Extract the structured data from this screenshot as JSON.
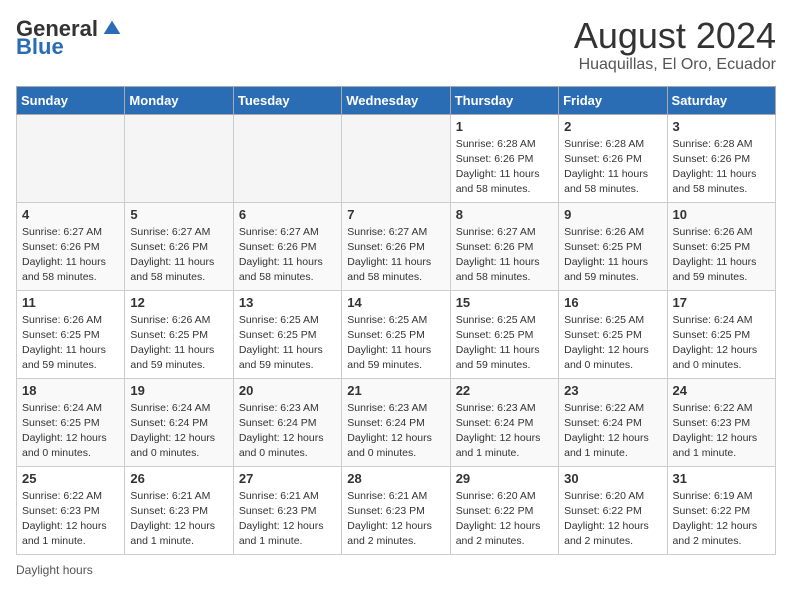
{
  "logo": {
    "general": "General",
    "blue": "Blue"
  },
  "title": "August 2024",
  "subtitle": "Huaquillas, El Oro, Ecuador",
  "weekdays": [
    "Sunday",
    "Monday",
    "Tuesday",
    "Wednesday",
    "Thursday",
    "Friday",
    "Saturday"
  ],
  "weeks": [
    [
      {
        "day": "",
        "info": ""
      },
      {
        "day": "",
        "info": ""
      },
      {
        "day": "",
        "info": ""
      },
      {
        "day": "",
        "info": ""
      },
      {
        "day": "1",
        "info": "Sunrise: 6:28 AM\nSunset: 6:26 PM\nDaylight: 11 hours and 58 minutes."
      },
      {
        "day": "2",
        "info": "Sunrise: 6:28 AM\nSunset: 6:26 PM\nDaylight: 11 hours and 58 minutes."
      },
      {
        "day": "3",
        "info": "Sunrise: 6:28 AM\nSunset: 6:26 PM\nDaylight: 11 hours and 58 minutes."
      }
    ],
    [
      {
        "day": "4",
        "info": "Sunrise: 6:27 AM\nSunset: 6:26 PM\nDaylight: 11 hours and 58 minutes."
      },
      {
        "day": "5",
        "info": "Sunrise: 6:27 AM\nSunset: 6:26 PM\nDaylight: 11 hours and 58 minutes."
      },
      {
        "day": "6",
        "info": "Sunrise: 6:27 AM\nSunset: 6:26 PM\nDaylight: 11 hours and 58 minutes."
      },
      {
        "day": "7",
        "info": "Sunrise: 6:27 AM\nSunset: 6:26 PM\nDaylight: 11 hours and 58 minutes."
      },
      {
        "day": "8",
        "info": "Sunrise: 6:27 AM\nSunset: 6:26 PM\nDaylight: 11 hours and 58 minutes."
      },
      {
        "day": "9",
        "info": "Sunrise: 6:26 AM\nSunset: 6:25 PM\nDaylight: 11 hours and 59 minutes."
      },
      {
        "day": "10",
        "info": "Sunrise: 6:26 AM\nSunset: 6:25 PM\nDaylight: 11 hours and 59 minutes."
      }
    ],
    [
      {
        "day": "11",
        "info": "Sunrise: 6:26 AM\nSunset: 6:25 PM\nDaylight: 11 hours and 59 minutes."
      },
      {
        "day": "12",
        "info": "Sunrise: 6:26 AM\nSunset: 6:25 PM\nDaylight: 11 hours and 59 minutes."
      },
      {
        "day": "13",
        "info": "Sunrise: 6:25 AM\nSunset: 6:25 PM\nDaylight: 11 hours and 59 minutes."
      },
      {
        "day": "14",
        "info": "Sunrise: 6:25 AM\nSunset: 6:25 PM\nDaylight: 11 hours and 59 minutes."
      },
      {
        "day": "15",
        "info": "Sunrise: 6:25 AM\nSunset: 6:25 PM\nDaylight: 11 hours and 59 minutes."
      },
      {
        "day": "16",
        "info": "Sunrise: 6:25 AM\nSunset: 6:25 PM\nDaylight: 12 hours and 0 minutes."
      },
      {
        "day": "17",
        "info": "Sunrise: 6:24 AM\nSunset: 6:25 PM\nDaylight: 12 hours and 0 minutes."
      }
    ],
    [
      {
        "day": "18",
        "info": "Sunrise: 6:24 AM\nSunset: 6:25 PM\nDaylight: 12 hours and 0 minutes."
      },
      {
        "day": "19",
        "info": "Sunrise: 6:24 AM\nSunset: 6:24 PM\nDaylight: 12 hours and 0 minutes."
      },
      {
        "day": "20",
        "info": "Sunrise: 6:23 AM\nSunset: 6:24 PM\nDaylight: 12 hours and 0 minutes."
      },
      {
        "day": "21",
        "info": "Sunrise: 6:23 AM\nSunset: 6:24 PM\nDaylight: 12 hours and 0 minutes."
      },
      {
        "day": "22",
        "info": "Sunrise: 6:23 AM\nSunset: 6:24 PM\nDaylight: 12 hours and 1 minute."
      },
      {
        "day": "23",
        "info": "Sunrise: 6:22 AM\nSunset: 6:24 PM\nDaylight: 12 hours and 1 minute."
      },
      {
        "day": "24",
        "info": "Sunrise: 6:22 AM\nSunset: 6:23 PM\nDaylight: 12 hours and 1 minute."
      }
    ],
    [
      {
        "day": "25",
        "info": "Sunrise: 6:22 AM\nSunset: 6:23 PM\nDaylight: 12 hours and 1 minute."
      },
      {
        "day": "26",
        "info": "Sunrise: 6:21 AM\nSunset: 6:23 PM\nDaylight: 12 hours and 1 minute."
      },
      {
        "day": "27",
        "info": "Sunrise: 6:21 AM\nSunset: 6:23 PM\nDaylight: 12 hours and 1 minute."
      },
      {
        "day": "28",
        "info": "Sunrise: 6:21 AM\nSunset: 6:23 PM\nDaylight: 12 hours and 2 minutes."
      },
      {
        "day": "29",
        "info": "Sunrise: 6:20 AM\nSunset: 6:22 PM\nDaylight: 12 hours and 2 minutes."
      },
      {
        "day": "30",
        "info": "Sunrise: 6:20 AM\nSunset: 6:22 PM\nDaylight: 12 hours and 2 minutes."
      },
      {
        "day": "31",
        "info": "Sunrise: 6:19 AM\nSunset: 6:22 PM\nDaylight: 12 hours and 2 minutes."
      }
    ]
  ],
  "footer": {
    "note": "Daylight hours"
  }
}
